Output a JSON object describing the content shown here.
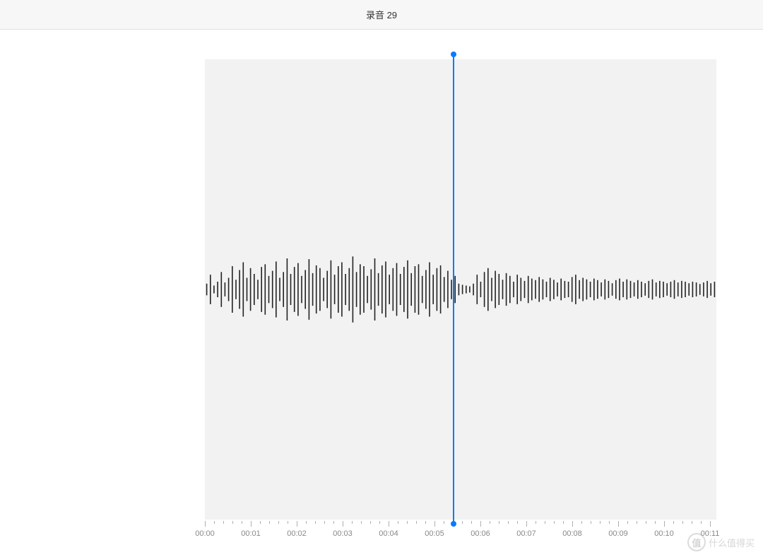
{
  "header": {
    "title": "录音 29"
  },
  "waveform": {
    "amplitudes": [
      15,
      38,
      10,
      20,
      45,
      18,
      30,
      60,
      25,
      50,
      70,
      30,
      55,
      40,
      25,
      58,
      65,
      35,
      48,
      72,
      30,
      45,
      80,
      40,
      58,
      68,
      35,
      50,
      78,
      42,
      62,
      55,
      30,
      48,
      75,
      38,
      60,
      70,
      40,
      55,
      85,
      45,
      65,
      60,
      35,
      52,
      80,
      42,
      62,
      72,
      38,
      55,
      68,
      40,
      58,
      75,
      42,
      60,
      65,
      35,
      50,
      70,
      38,
      55,
      62,
      32,
      48,
      25,
      35,
      15,
      12,
      10,
      8,
      15,
      38,
      20,
      45,
      55,
      30,
      48,
      40,
      25,
      42,
      35,
      20,
      38,
      30,
      22,
      35,
      28,
      24,
      32,
      26,
      20,
      30,
      25,
      18,
      28,
      22,
      20,
      32,
      38,
      24,
      30,
      26,
      20,
      28,
      24,
      18,
      26,
      22,
      16,
      24,
      28,
      20,
      26,
      22,
      18,
      24,
      20,
      16,
      22,
      26,
      18,
      22,
      20,
      16,
      20,
      24,
      18,
      22,
      20,
      16,
      20,
      18,
      14,
      18,
      22,
      16,
      20
    ]
  },
  "playhead": {
    "position_sec": 5.4
  },
  "timeline": {
    "ticks": [
      {
        "label": "00:00",
        "pos": 0
      },
      {
        "label": "00:01",
        "pos": 65
      },
      {
        "label": "00:02",
        "pos": 130
      },
      {
        "label": "00:03",
        "pos": 195
      },
      {
        "label": "00:04",
        "pos": 260
      },
      {
        "label": "00:05",
        "pos": 325
      },
      {
        "label": "00:06",
        "pos": 390
      },
      {
        "label": "00:07",
        "pos": 455
      },
      {
        "label": "00:08",
        "pos": 520
      },
      {
        "label": "00:09",
        "pos": 585
      },
      {
        "label": "00:10",
        "pos": 650
      },
      {
        "label": "00:11",
        "pos": 715
      }
    ]
  },
  "watermark": {
    "circle_text": "值",
    "label": "什么值得买"
  }
}
